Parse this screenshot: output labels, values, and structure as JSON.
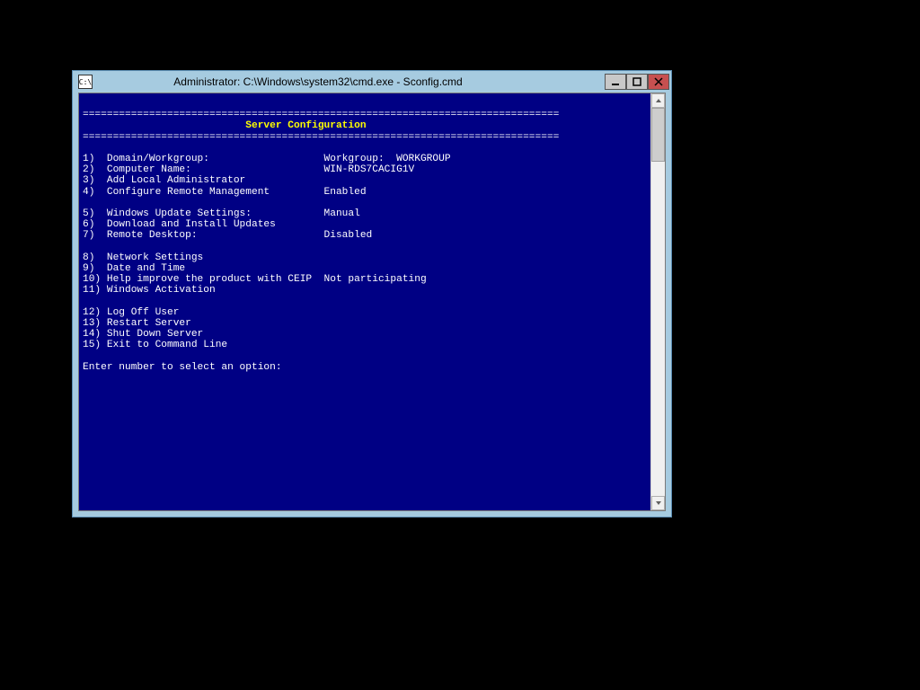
{
  "window": {
    "title": "Administrator: C:\\Windows\\system32\\cmd.exe - Sconfig.cmd",
    "icon_glyph": "C:\\"
  },
  "divider": "===============================================================================",
  "header": "                           Server Configuration                                ",
  "menu": {
    "items": [
      {
        "num": "1",
        "label": "Domain/Workgroup:",
        "value": "Workgroup:  WORKGROUP"
      },
      {
        "num": "2",
        "label": "Computer Name:",
        "value": "WIN-RDS7CACIG1V"
      },
      {
        "num": "3",
        "label": "Add Local Administrator",
        "value": ""
      },
      {
        "num": "4",
        "label": "Configure Remote Management",
        "value": "Enabled"
      }
    ],
    "items2": [
      {
        "num": "5",
        "label": "Windows Update Settings:",
        "value": "Manual"
      },
      {
        "num": "6",
        "label": "Download and Install Updates",
        "value": ""
      },
      {
        "num": "7",
        "label": "Remote Desktop:",
        "value": "Disabled"
      }
    ],
    "items3": [
      {
        "num": "8",
        "label": "Network Settings",
        "value": ""
      },
      {
        "num": "9",
        "label": "Date and Time",
        "value": ""
      },
      {
        "num": "10",
        "label": "Help improve the product with CEIP",
        "value": "Not participating"
      },
      {
        "num": "11",
        "label": "Windows Activation",
        "value": ""
      }
    ],
    "items4": [
      {
        "num": "12",
        "label": "Log Off User",
        "value": ""
      },
      {
        "num": "13",
        "label": "Restart Server",
        "value": ""
      },
      {
        "num": "14",
        "label": "Shut Down Server",
        "value": ""
      },
      {
        "num": "15",
        "label": "Exit to Command Line",
        "value": ""
      }
    ]
  },
  "prompt": "Enter number to select an option:"
}
